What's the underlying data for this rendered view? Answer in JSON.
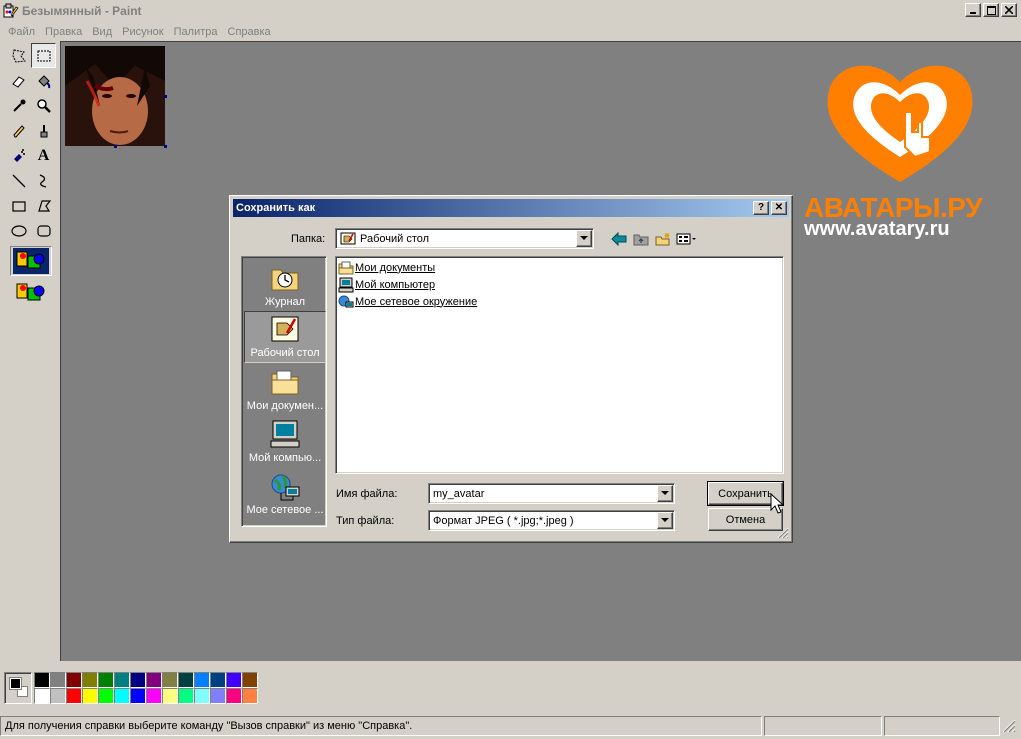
{
  "window": {
    "title": "Безымянный - Paint",
    "app_icon": "paint-icon",
    "controls": [
      "minimize-icon",
      "maximize-icon",
      "close-icon"
    ]
  },
  "menu": [
    "Файл",
    "Правка",
    "Вид",
    "Рисунок",
    "Палитра",
    "Справка"
  ],
  "toolbox": {
    "tools": [
      "free-select-icon",
      "rect-select-icon",
      "eraser-icon",
      "fill-icon",
      "color-picker-icon",
      "magnifier-icon",
      "pencil-icon",
      "brush-icon",
      "airbrush-icon",
      "text-icon",
      "line-icon",
      "curve-icon",
      "rectangle-icon",
      "polygon-icon",
      "ellipse-icon",
      "rounded-rect-icon"
    ],
    "active_tool": "rect-select-icon",
    "text_tool_label": "A"
  },
  "watermark": {
    "brand": "АВАТАРЫ.РУ",
    "url": "www.avatary.ru",
    "color": "#ff7f00"
  },
  "dialog": {
    "title": "Сохранить как",
    "help_label": "?",
    "close_label": "✕",
    "lookin_label": "Папка:",
    "lookin_value": "Рабочий стол",
    "nav_icons": [
      "back-icon",
      "up-folder-icon",
      "new-folder-icon",
      "view-menu-icon"
    ],
    "places": [
      {
        "label": "Журнал",
        "icon": "history-icon",
        "active": false
      },
      {
        "label": "Рабочий стол",
        "icon": "desktop-icon",
        "active": true
      },
      {
        "label": "Мои докумен...",
        "icon": "my-documents-icon",
        "active": false
      },
      {
        "label": "Мой компью...",
        "icon": "my-computer-icon",
        "active": false
      },
      {
        "label": "Мое сетевое ...",
        "icon": "network-icon",
        "active": false
      }
    ],
    "files": [
      {
        "name": "Мои документы",
        "icon": "folder-icon"
      },
      {
        "name": "Мой компьютер",
        "icon": "computer-icon"
      },
      {
        "name": "Мое сетевое окружение",
        "icon": "network-icon"
      }
    ],
    "filename_label": "Имя файла:",
    "filename_value": "my_avatar",
    "filetype_label": "Тип файла:",
    "filetype_value": "Формат JPEG ( *.jpg;*.jpeg )",
    "save_label": "Сохранить",
    "cancel_label": "Отмена"
  },
  "palette": {
    "foreground": "#000000",
    "background": "#ffffff",
    "colors": [
      "#000000",
      "#808080",
      "#800000",
      "#808000",
      "#008000",
      "#008080",
      "#000080",
      "#800080",
      "#808040",
      "#004040",
      "#0080ff",
      "#004080",
      "#4000ff",
      "#804000",
      "#ffffff",
      "#c0c0c0",
      "#ff0000",
      "#ffff00",
      "#00ff00",
      "#00ffff",
      "#0000ff",
      "#ff00ff",
      "#ffff80",
      "#00ff80",
      "#80ffff",
      "#8080ff",
      "#ff0080",
      "#ff8040"
    ]
  },
  "status": {
    "text": "Для получения справки выберите команду \"Вызов справки\" из меню \"Справка\"."
  }
}
